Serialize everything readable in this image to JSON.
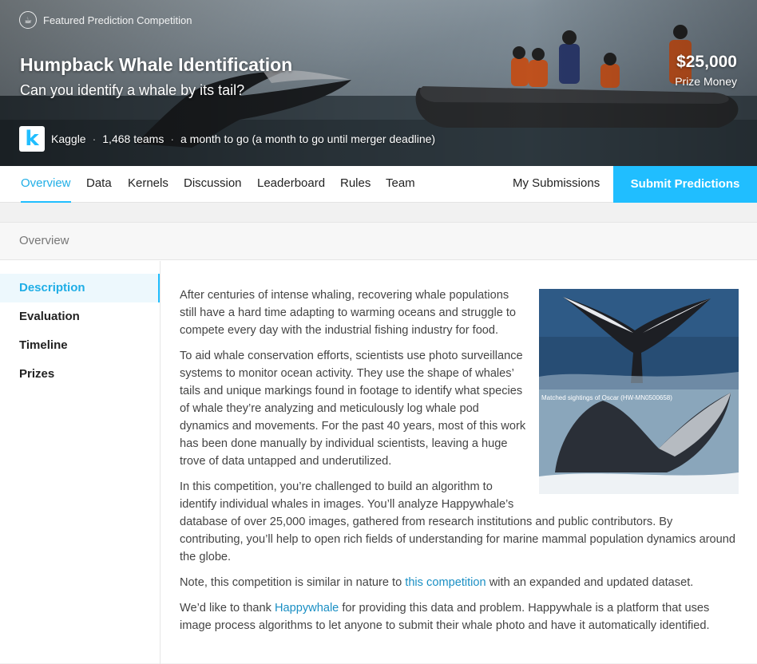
{
  "hero": {
    "badge_label": "Featured Prediction Competition",
    "badge_icon": "trophy-icon",
    "title": "Humpback Whale Identification",
    "subtitle": "Can you identify a whale by its tail?",
    "prize_amount": "$25,000",
    "prize_label": "Prize Money",
    "host": "Kaggle",
    "host_logo_letter": "k",
    "teams": "1,468 teams",
    "deadline": "a month to go (a month to go until merger deadline)",
    "separator": "·"
  },
  "tabs": [
    {
      "label": "Overview",
      "active": true
    },
    {
      "label": "Data"
    },
    {
      "label": "Kernels"
    },
    {
      "label": "Discussion"
    },
    {
      "label": "Leaderboard"
    },
    {
      "label": "Rules"
    },
    {
      "label": "Team"
    }
  ],
  "my_submissions": "My Submissions",
  "submit_predictions": "Submit Predictions",
  "card": {
    "heading": "Overview",
    "nav": [
      {
        "label": "Description",
        "active": true
      },
      {
        "label": "Evaluation"
      },
      {
        "label": "Timeline"
      },
      {
        "label": "Prizes"
      }
    ]
  },
  "description": {
    "photo_caption": "Matched sightings of Oscar (HW-MN0500658)",
    "p1": "After centuries of intense whaling, recovering whale populations still have a hard time adapting to warming oceans and struggle to compete every day with the industrial fishing industry for food.",
    "p2": "To aid whale conservation efforts, scientists use photo surveillance systems to monitor ocean activity. They use the shape of whales’ tails and unique markings found in footage to identify what species of whale they’re analyzing and meticulously log whale pod dynamics and movements. For the past 40 years, most of this work has been done manually by individual scientists, leaving a huge trove of data untapped and underutilized.",
    "p3": "In this competition, you’re challenged to build an algorithm to identify individual whales in images. You’ll analyze Happywhale’s database of over 25,000 images, gathered from research institutions and public contributors. By contributing, you’ll help to open rich fields of understanding for marine mammal population dynamics around the globe.",
    "p4_before": "Note, this competition is similar in nature to ",
    "p4_link": "this competition",
    "p4_after": " with an expanded and updated dataset.",
    "p5_before": "We’d like to thank ",
    "p5_link": "Happywhale",
    "p5_after": " for providing this data and problem. Happywhale is a platform that uses image process algorithms to let anyone to submit their whale photo and have it automatically identified."
  },
  "colors": {
    "accent": "#20beff",
    "link": "#1a8fc4"
  }
}
